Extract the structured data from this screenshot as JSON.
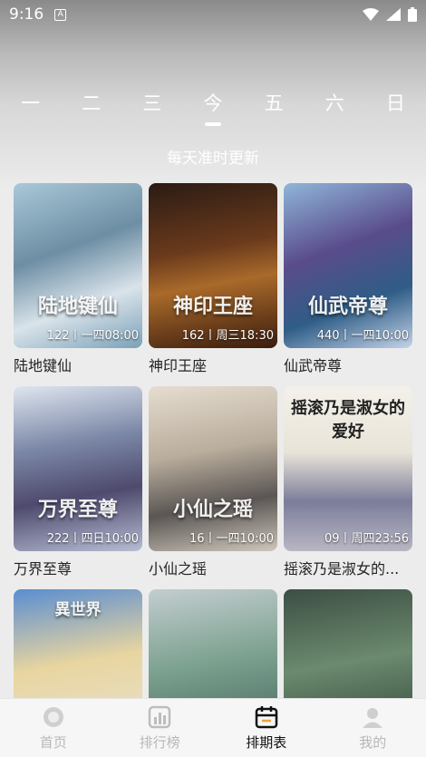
{
  "status": {
    "time": "9:16",
    "a_badge": "A"
  },
  "days": [
    "一",
    "二",
    "三",
    "今",
    "五",
    "六",
    "日"
  ],
  "active_day_index": 3,
  "subtitle": "每天准时更新",
  "cards": [
    {
      "name": "陆地键仙",
      "art_title": "陆地键仙",
      "badge": "122丨一四08:00"
    },
    {
      "name": "神印王座",
      "art_title": "神印王座",
      "badge": "162丨周三18:30"
    },
    {
      "name": "仙武帝尊",
      "art_title": "仙武帝尊",
      "badge": "440丨一四10:00"
    },
    {
      "name": "万界至尊",
      "art_title": "万界至尊",
      "badge": "222丨四日10:00"
    },
    {
      "name": "小仙之瑶",
      "art_title": "小仙之瑶",
      "badge": "16丨一四10:00"
    },
    {
      "name": "摇滚乃是淑女的...",
      "art_title": "摇滚乃是淑女的爱好",
      "badge": "09丨周四23:56"
    },
    {
      "name": "",
      "art_title": "異世界",
      "badge": ""
    },
    {
      "name": "",
      "art_title": "",
      "badge": ""
    },
    {
      "name": "",
      "art_title": "",
      "badge": ""
    }
  ],
  "nav": [
    {
      "label": "首页",
      "icon": "home-icon"
    },
    {
      "label": "排行榜",
      "icon": "ranking-icon"
    },
    {
      "label": "排期表",
      "icon": "calendar-icon"
    },
    {
      "label": "我的",
      "icon": "profile-icon"
    }
  ],
  "active_nav_index": 2
}
